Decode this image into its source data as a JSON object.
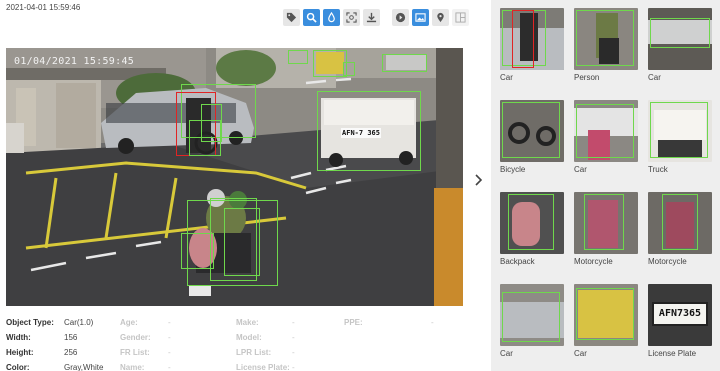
{
  "header": {
    "timestamp": "2021-04-01 15:59:46"
  },
  "toolbar": {
    "buttons": [
      {
        "name": "tag-icon"
      },
      {
        "name": "zoom-icon"
      },
      {
        "name": "drop-icon"
      },
      {
        "name": "face-scan-icon"
      },
      {
        "name": "download-icon"
      },
      {
        "name": "play-icon"
      },
      {
        "name": "image-icon"
      },
      {
        "name": "location-pin-icon"
      },
      {
        "name": "layout-icon"
      }
    ],
    "active_color": "#3a8ede"
  },
  "viewer": {
    "overlay_time": "01/04/2021 15:59:45"
  },
  "plate_text": "AFN-7 365",
  "thumbnails": [
    {
      "caption": "Car"
    },
    {
      "caption": "Person"
    },
    {
      "caption": "Car"
    },
    {
      "caption": "Bicycle"
    },
    {
      "caption": "Car"
    },
    {
      "caption": "Truck"
    },
    {
      "caption": "Backpack"
    },
    {
      "caption": "Motorcycle"
    },
    {
      "caption": "Motorcycle"
    },
    {
      "caption": "Car"
    },
    {
      "caption": "Car"
    },
    {
      "caption": "License Plate"
    }
  ],
  "thumb_plate": "AFN7365",
  "details": {
    "object_type": {
      "label": "Object Type:",
      "value": "Car(1.0)"
    },
    "width": {
      "label": "Width:",
      "value": "156"
    },
    "height": {
      "label": "Height:",
      "value": "256"
    },
    "color": {
      "label": "Color:",
      "value": "Gray,White"
    },
    "age": {
      "label": "Age:",
      "value": "-"
    },
    "gender": {
      "label": "Gender:",
      "value": "-"
    },
    "fr_list": {
      "label": "FR List:",
      "value": "-"
    },
    "name": {
      "label": "Name:",
      "value": "-"
    },
    "make": {
      "label": "Make:",
      "value": "-"
    },
    "model": {
      "label": "Model:",
      "value": "-"
    },
    "lpr_list": {
      "label": "LPR List:",
      "value": "-"
    },
    "license_plate": {
      "label": "License Plate:",
      "value": "-"
    },
    "ppe": {
      "label": "PPE:",
      "value": "-"
    }
  },
  "colors": {
    "detection": "#6fd84c",
    "selected": "#e02424"
  }
}
